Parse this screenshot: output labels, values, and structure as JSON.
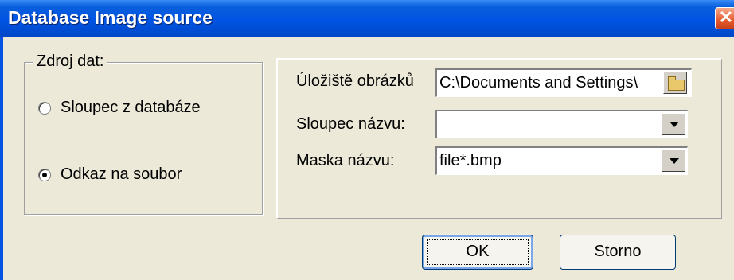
{
  "window": {
    "title": "Database Image source",
    "close_glyph": "✕"
  },
  "group": {
    "legend": "Zdroj dat:",
    "options": [
      {
        "label": "Sloupec z databáze",
        "checked": false
      },
      {
        "label": "Odkaz na soubor",
        "checked": true
      }
    ]
  },
  "fields": {
    "storage": {
      "label": "Úložiště obrázků",
      "value": "C:\\Documents and Settings\\"
    },
    "name_column": {
      "label": "Sloupec názvu:",
      "value": ""
    },
    "name_mask": {
      "label": "Maska názvu:",
      "value": "file*.bmp"
    }
  },
  "buttons": {
    "ok": "OK",
    "cancel": "Storno"
  },
  "icons": {
    "close": "close-icon",
    "folder": "folder-icon",
    "dropdown": "chevron-down-icon"
  }
}
